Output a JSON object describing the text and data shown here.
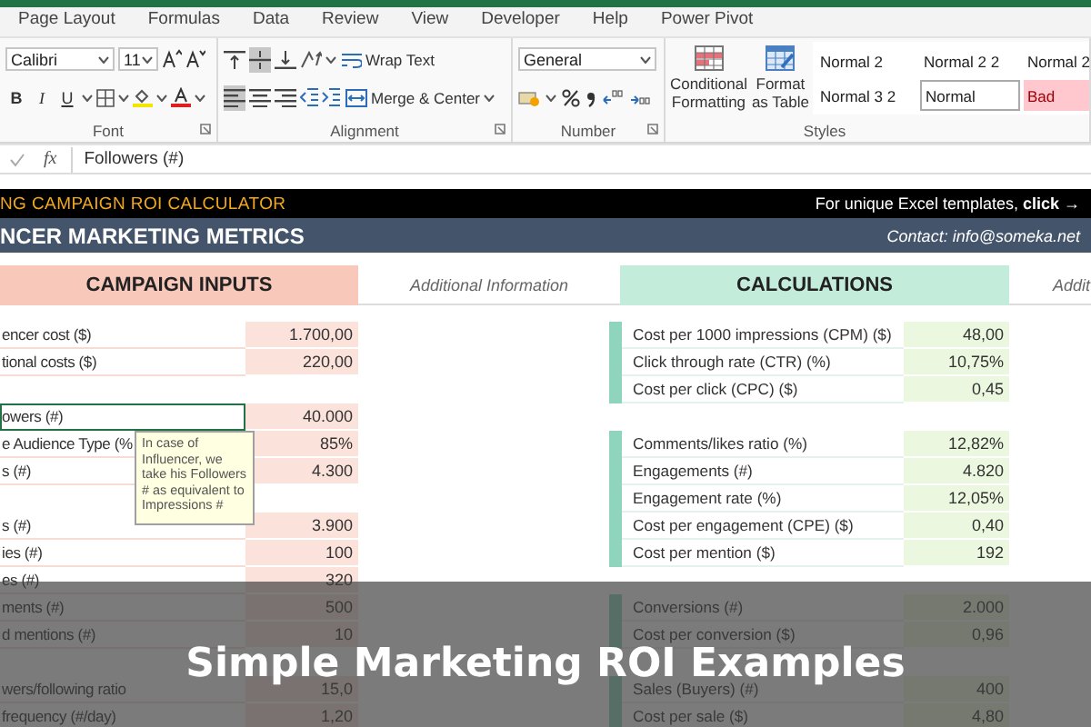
{
  "ribbon": {
    "tabs": [
      {
        "label": "Page Layout",
        "selected": false
      },
      {
        "label": "Formulas",
        "selected": false
      },
      {
        "label": "Data",
        "selected": false
      },
      {
        "label": "Review",
        "selected": false
      },
      {
        "label": "View",
        "selected": false
      },
      {
        "label": "Developer",
        "selected": false
      },
      {
        "label": "Help",
        "selected": false
      },
      {
        "label": "Power Pivot",
        "selected": false
      }
    ],
    "font": {
      "name": "Calibri",
      "size": "11",
      "bold": "B",
      "italic": "I",
      "underline": "U",
      "label": "Font"
    },
    "alignment": {
      "vertical": [
        {
          "selected": false
        },
        {
          "selected": true
        },
        {
          "selected": false
        }
      ],
      "horizontal": [
        {
          "selected": true
        },
        {
          "selected": false
        },
        {
          "selected": false
        }
      ],
      "wrap_text": "Wrap Text",
      "merge": "Merge & Center",
      "label": "Alignment"
    },
    "number": {
      "format": "General",
      "label": "Number"
    },
    "styles": {
      "conditional": "Conditional Formatting",
      "format_table": "Format as Table",
      "label": "Styles",
      "gallery": [
        {
          "label": "Normal 2",
          "kind": "plain"
        },
        {
          "label": "Normal 2 2",
          "kind": "plain"
        },
        {
          "label": "Normal 2",
          "kind": "plain"
        },
        {
          "label": "Normal 3 2",
          "kind": "plain"
        },
        {
          "label": "Normal",
          "kind": "boxed"
        },
        {
          "label": "Bad",
          "kind": "bad"
        }
      ]
    }
  },
  "formula_bar": {
    "fx": "fx",
    "content": "Followers (#)"
  },
  "sheet": {
    "title": "NG CAMPAIGN ROI CALCULATOR",
    "promo": "For unique Excel templates, **click →**",
    "subtitle": "NCER MARKETING METRICS",
    "contact": "Contact: info@someka.net",
    "inputs_header": "CAMPAIGN INPUTS",
    "info_header": "Additional Information",
    "calc_header": "CALCULATIONS",
    "info_header_2": "Addit",
    "inputs": [
      [
        {
          "label": "encer cost ($)",
          "value": "1.700,00",
          "selected": false
        },
        {
          "label": "tional costs ($)",
          "value": "220,00",
          "selected": false
        }
      ],
      [
        {
          "label": "owers (#)",
          "value": "40.000",
          "selected": true
        },
        {
          "label": "e Audience Type (%",
          "value": "85%",
          "selected": false
        },
        {
          "label": "s (#)",
          "value": "4.300",
          "selected": false
        }
      ],
      [
        {
          "label": "s (#)",
          "value": "3.900",
          "selected": false
        },
        {
          "label": "ies (#)",
          "value": "100",
          "selected": false
        },
        {
          "label": "es (#)",
          "value": "320",
          "selected": false
        },
        {
          "label": "ments (#)",
          "value": "500",
          "selected": false
        },
        {
          "label": "d mentions (#)",
          "value": "10",
          "selected": false
        }
      ],
      [
        {
          "label": "wers/following ratio",
          "value": "15,0",
          "selected": false
        },
        {
          "label": "frequency (#/day)",
          "value": "1,20",
          "selected": false
        }
      ]
    ],
    "calculations": [
      [
        {
          "label": "Cost per 1000 impressions (CPM) ($)",
          "value": "48,00"
        },
        {
          "label": "Click through rate (CTR) (%)",
          "value": "10,75%"
        },
        {
          "label": "Cost per click (CPC) ($)",
          "value": "0,45"
        }
      ],
      [
        {
          "label": "Comments/likes ratio (%)",
          "value": "12,82%"
        },
        {
          "label": "Engagements (#)",
          "value": "4.820"
        },
        {
          "label": "Engagement rate (%)",
          "value": "12,05%"
        },
        {
          "label": "Cost per engagement (CPE) ($)",
          "value": "0,40"
        },
        {
          "label": "Cost per mention ($)",
          "value": "192"
        }
      ],
      [
        {
          "label": "Conversions (#)",
          "value": "2.000"
        },
        {
          "label": "Cost per conversion ($)",
          "value": "0,96"
        }
      ],
      [
        {
          "label": "Sales (Buyers) (#)",
          "value": "400"
        },
        {
          "label": "Cost per sale ($)",
          "value": "4,80"
        }
      ]
    ],
    "comment": "In case of Influencer, we take his Followers # as equivalent to Impressions #"
  },
  "banner": {
    "title": "Simple Marketing ROI Examples"
  }
}
